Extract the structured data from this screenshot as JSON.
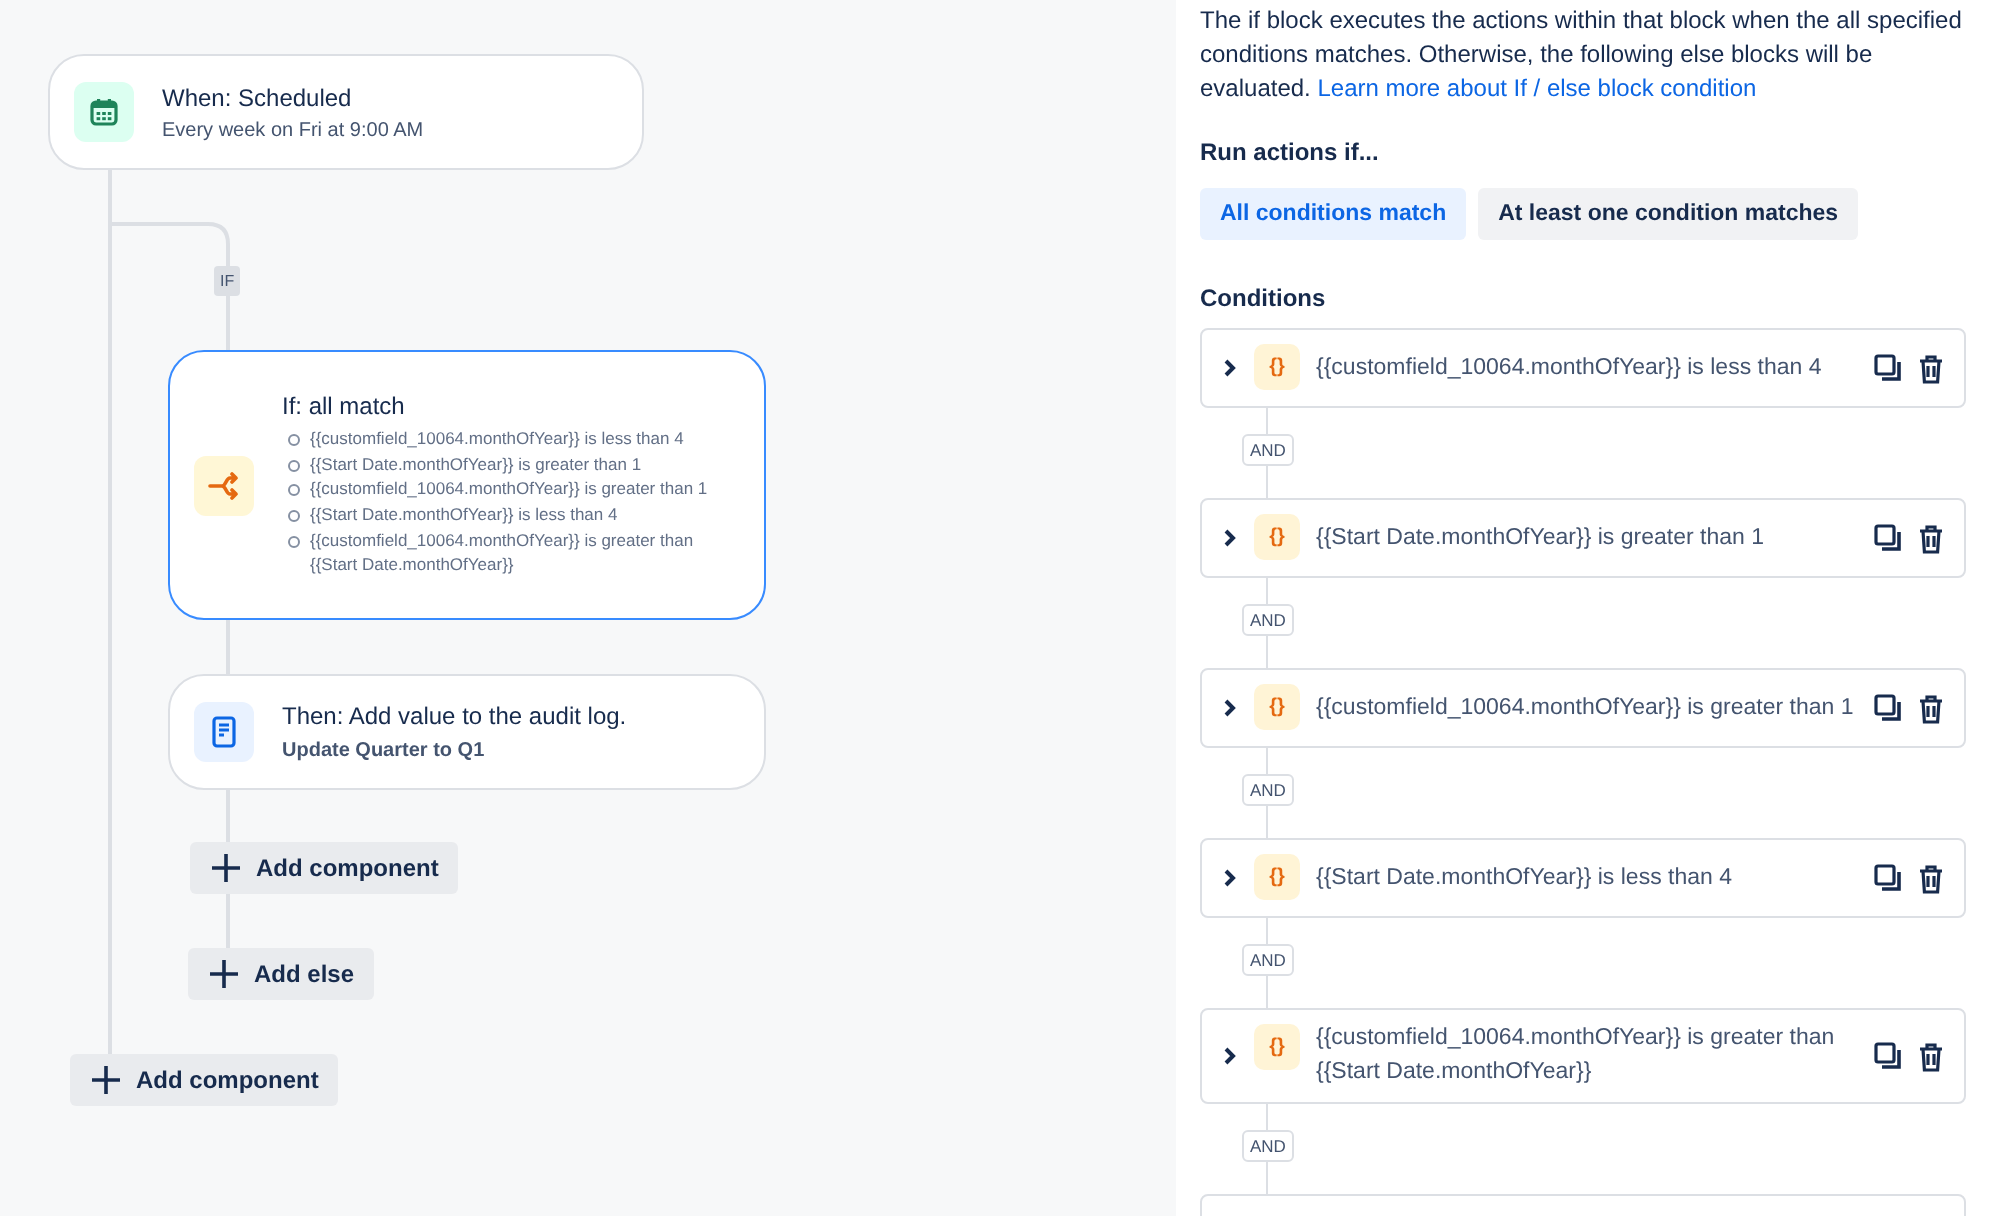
{
  "trigger": {
    "title": "When: Scheduled",
    "subtitle": "Every week on Fri at 9:00 AM"
  },
  "branch_label": "IF",
  "if_block": {
    "title": "If: all match",
    "selected": true,
    "conditions": [
      "{{customfield_10064.monthOfYear}} is less than 4",
      "{{Start Date.monthOfYear}} is greater than 1",
      "{{customfield_10064.monthOfYear}} is greater than 1",
      "{{Start Date.monthOfYear}} is less than 4",
      "{{customfield_10064.monthOfYear}} is greater than {{Start Date.monthOfYear}}"
    ]
  },
  "action": {
    "title": "Then: Add value to the audit log.",
    "subtitle": "Update Quarter to Q1"
  },
  "add_buttons": [
    {
      "label": "Add component"
    },
    {
      "label": "Add else"
    },
    {
      "label": "Add component"
    }
  ],
  "panel": {
    "description": "The if block executes the actions within that block when the all specified conditions matches. Otherwise, the following else blocks will be evaluated.",
    "link": "Learn more about If / else block condition",
    "run_label": "Run actions if...",
    "match_options": [
      {
        "label": "All conditions match",
        "selected": true
      },
      {
        "label": "At least one condition matches",
        "selected": false
      }
    ],
    "conditions_label": "Conditions",
    "conditions": [
      {
        "badge": "{}",
        "text": "{{customfield_10064.monthOfYear}} is less than 4",
        "connector": "AND"
      },
      {
        "badge": "{}",
        "text": "{{Start Date.monthOfYear}} is greater than 1",
        "connector": "AND"
      },
      {
        "badge": "{}",
        "text": "{{customfield_10064.monthOfYear}} is greater than 1",
        "connector": "AND"
      },
      {
        "badge": "{}",
        "text": "{{Start Date.monthOfYear}} is less than 4",
        "connector": "AND"
      },
      {
        "badge": "{}",
        "text": "{{customfield_10064.monthOfYear}} is greater than {{Start Date.monthOfYear}}",
        "connector": "AND"
      }
    ]
  }
}
